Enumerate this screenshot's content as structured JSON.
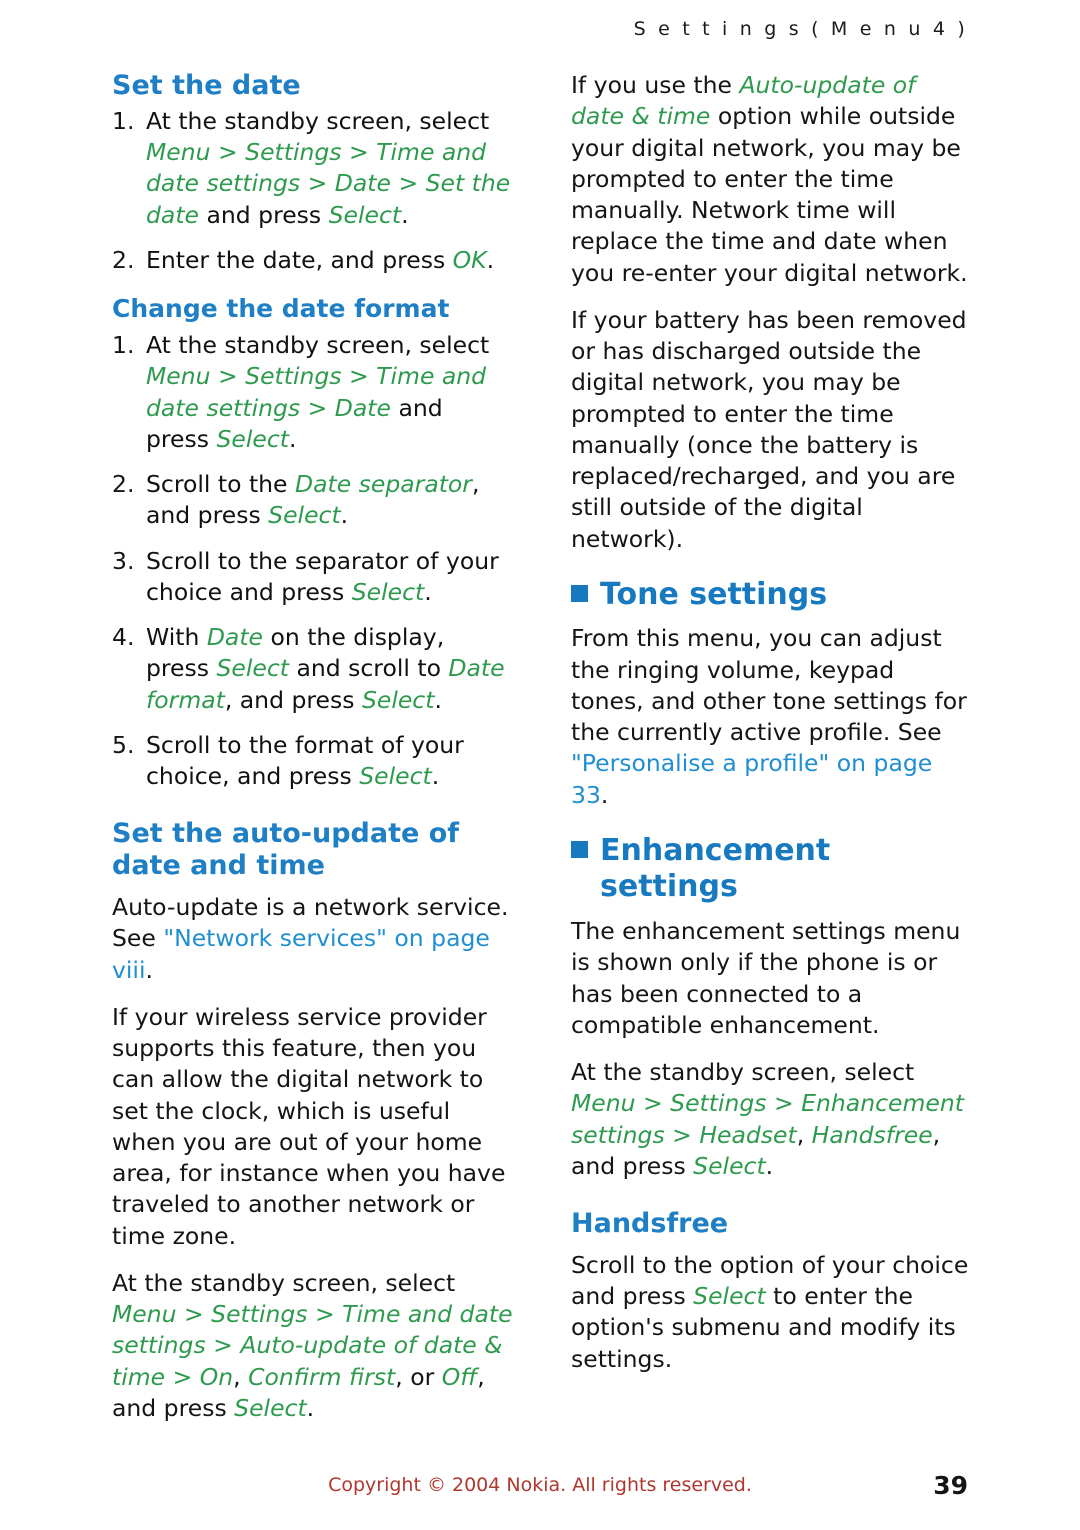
{
  "header": "S e t t i n g s   ( M e n u   4 )",
  "colors": {
    "heading_blue": "#1f7fc4",
    "major_blue": "#1779c0",
    "italic_green": "#2e9a4e",
    "footer_red": "#b0372f"
  },
  "left_column": {
    "h_set_the_date": "Set the date",
    "set_the_date_steps": [
      {
        "num": "1.",
        "parts": [
          {
            "t": "At the standby screen, select ",
            "s": "plain"
          },
          {
            "t": "Menu > Settings > Time and date settings > Date > Set the date",
            "s": "green-italic"
          },
          {
            "t": " and press ",
            "s": "plain"
          },
          {
            "t": "Select",
            "s": "green-italic"
          },
          {
            "t": ".",
            "s": "plain"
          }
        ]
      },
      {
        "num": "2.",
        "parts": [
          {
            "t": "Enter the date, and press ",
            "s": "plain"
          },
          {
            "t": "OK",
            "s": "green-italic"
          },
          {
            "t": ".",
            "s": "plain"
          }
        ]
      }
    ],
    "h_change_date_format": "Change the date format",
    "change_format_steps": [
      {
        "num": "1.",
        "parts": [
          {
            "t": "At the standby screen, select ",
            "s": "plain"
          },
          {
            "t": "Menu > Settings > Time and date settings > Date",
            "s": "green-italic"
          },
          {
            "t": " and press ",
            "s": "plain"
          },
          {
            "t": "Select",
            "s": "green-italic"
          },
          {
            "t": ".",
            "s": "plain"
          }
        ]
      },
      {
        "num": "2.",
        "parts": [
          {
            "t": "Scroll to the ",
            "s": "plain"
          },
          {
            "t": "Date separator",
            "s": "green-italic"
          },
          {
            "t": ", and press ",
            "s": "plain"
          },
          {
            "t": "Select",
            "s": "green-italic"
          },
          {
            "t": ".",
            "s": "plain"
          }
        ]
      },
      {
        "num": "3.",
        "parts": [
          {
            "t": "Scroll to the separator of your choice and press ",
            "s": "plain"
          },
          {
            "t": "Select",
            "s": "green-italic"
          },
          {
            "t": ".",
            "s": "plain"
          }
        ]
      },
      {
        "num": "4.",
        "parts": [
          {
            "t": "With ",
            "s": "plain"
          },
          {
            "t": "Date",
            "s": "green-italic"
          },
          {
            "t": " on the display, press ",
            "s": "plain"
          },
          {
            "t": "Select",
            "s": "green-italic"
          },
          {
            "t": " and scroll to ",
            "s": "plain"
          },
          {
            "t": "Date format",
            "s": "green-italic"
          },
          {
            "t": ", and press ",
            "s": "plain"
          },
          {
            "t": "Select",
            "s": "green-italic"
          },
          {
            "t": ".",
            "s": "plain"
          }
        ]
      },
      {
        "num": "5.",
        "parts": [
          {
            "t": "Scroll to the format of your choice, and press ",
            "s": "plain"
          },
          {
            "t": "Select",
            "s": "green-italic"
          },
          {
            "t": ".",
            "s": "plain"
          }
        ]
      }
    ],
    "h_auto_update": "Set the auto-update of date and time",
    "para_network_service": [
      {
        "t": "Auto-update is a network service. See ",
        "s": "plain"
      },
      {
        "t": "\"Network services\" on page viii",
        "s": "blue"
      },
      {
        "t": ".",
        "s": "plain"
      }
    ],
    "para_wireless_provider": [
      {
        "t": "If your wireless service provider supports this feature, then you can allow the digital network to set the clock, which is useful when you are out of your home area, for instance when you have traveled to another network or time zone.",
        "s": "plain"
      }
    ],
    "para_standby_path": [
      {
        "t": "At the standby screen, select ",
        "s": "plain"
      },
      {
        "t": "Menu > Settings > Time and date settings > Auto-update of date & time > On",
        "s": "green-italic"
      },
      {
        "t": ", ",
        "s": "plain"
      },
      {
        "t": "Confirm first",
        "s": "green-italic"
      },
      {
        "t": ", or ",
        "s": "plain"
      },
      {
        "t": "Off",
        "s": "green-italic"
      },
      {
        "t": ", and press ",
        "s": "plain"
      },
      {
        "t": "Select",
        "s": "green-italic"
      },
      {
        "t": ".",
        "s": "plain"
      }
    ]
  },
  "right_column": {
    "para_auto_update_outside": [
      {
        "t": "If you use the ",
        "s": "plain"
      },
      {
        "t": "Auto-update of date & time",
        "s": "green-italic"
      },
      {
        "t": " option while outside your digital network, you may be prompted to enter the time manually. Network time will replace the time and date when you re-enter your digital network.",
        "s": "plain"
      }
    ],
    "para_battery_removed": [
      {
        "t": "If your battery has been removed or has discharged outside the digital network, you may be prompted to enter the time manually (once the battery is replaced/recharged, and you are still outside of the digital network).",
        "s": "plain"
      }
    ],
    "h_tone_settings": "Tone settings",
    "para_tone_settings": [
      {
        "t": "From this menu, you can adjust the ringing volume, keypad tones, and other tone settings for the currently active profile. See ",
        "s": "plain"
      },
      {
        "t": "\"Personalise a profile\" on page 33",
        "s": "blue"
      },
      {
        "t": ".",
        "s": "plain"
      }
    ],
    "h_enhancement_settings": "Enhancement settings",
    "para_enhancement_intro": [
      {
        "t": "The enhancement settings menu is shown only if the phone is or has been connected to a compatible enhancement.",
        "s": "plain"
      }
    ],
    "para_enhancement_path": [
      {
        "t": "At the standby screen, select ",
        "s": "plain"
      },
      {
        "t": "Menu > Settings > Enhancement settings > Headset",
        "s": "green-italic"
      },
      {
        "t": ", ",
        "s": "plain"
      },
      {
        "t": "Handsfree",
        "s": "green-italic"
      },
      {
        "t": ", and press ",
        "s": "plain"
      },
      {
        "t": "Select",
        "s": "green-italic"
      },
      {
        "t": ".",
        "s": "plain"
      }
    ],
    "h_handsfree": "Handsfree",
    "para_handsfree": [
      {
        "t": "Scroll to the option of your choice and press ",
        "s": "plain"
      },
      {
        "t": "Select",
        "s": "green-italic"
      },
      {
        "t": " to enter the option's submenu and modify its settings.",
        "s": "plain"
      }
    ]
  },
  "footer": {
    "copyright": "Copyright © 2004 Nokia. All rights reserved.",
    "page_number": "39"
  }
}
